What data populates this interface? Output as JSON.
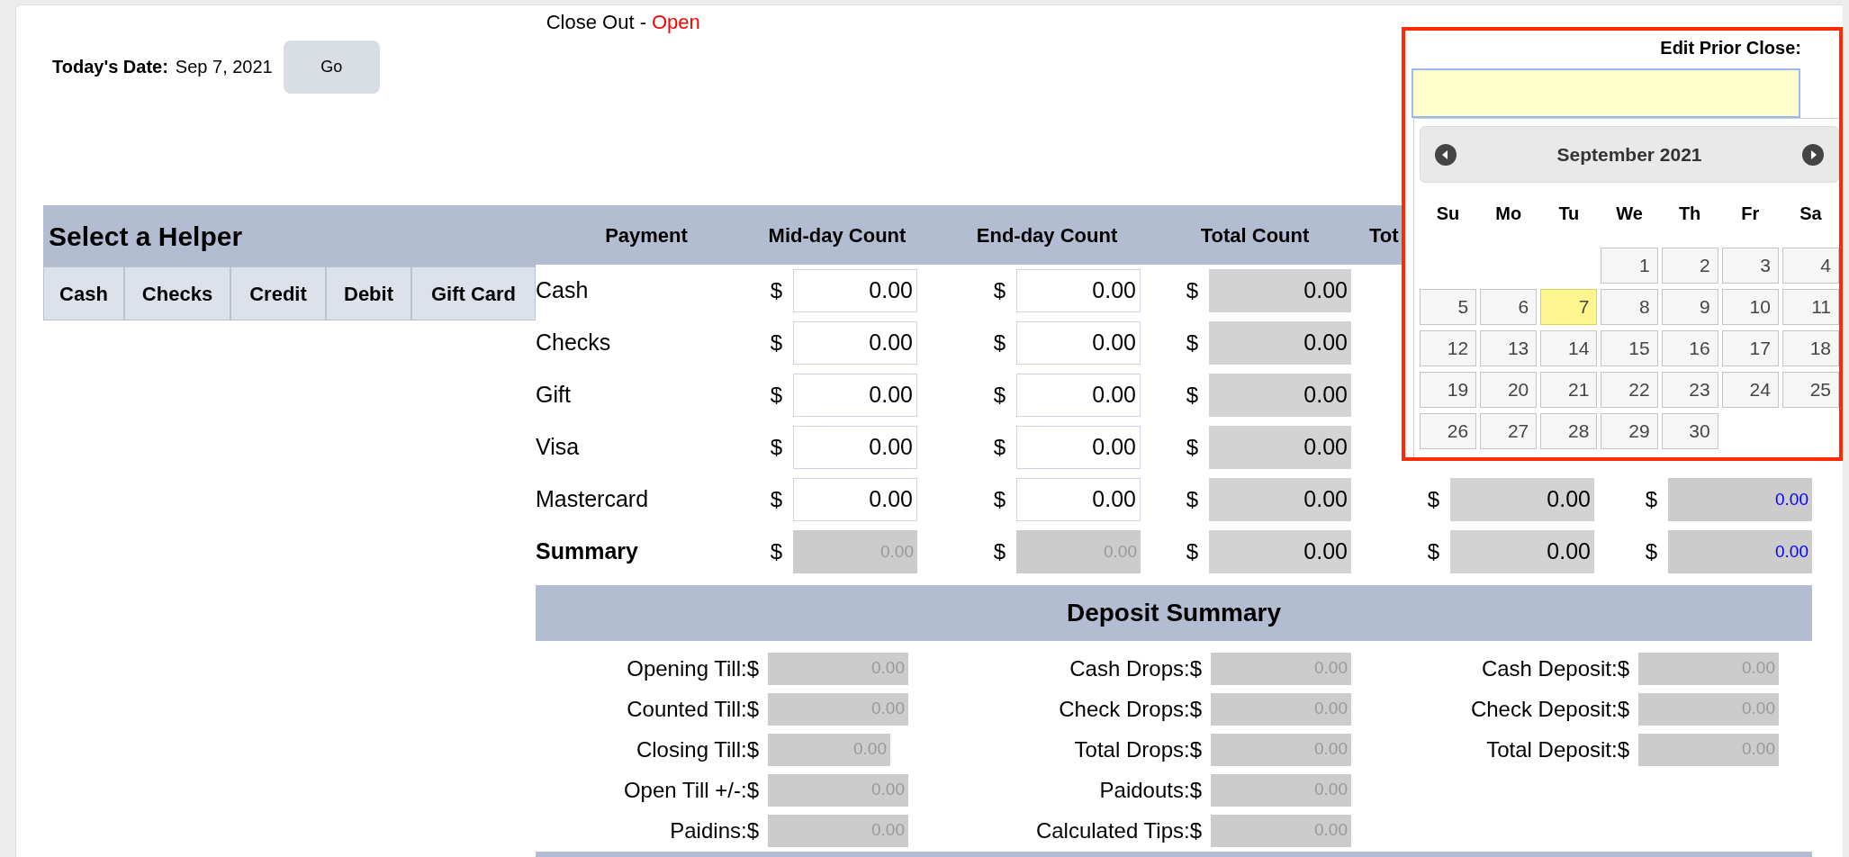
{
  "header": {
    "title": "Close Out -",
    "status": "Open",
    "date_label": "Today's Date:",
    "date": "Sep 7, 2021",
    "go_button": "Go"
  },
  "helper": {
    "title": "Select a Helper",
    "tabs": [
      "Cash",
      "Checks",
      "Credit",
      "Debit",
      "Gift Card"
    ]
  },
  "payments": {
    "columns": [
      "Payment",
      "Mid-day Count",
      "End-day Count",
      "Total Count",
      "Tot"
    ],
    "rows": [
      {
        "kind": "item",
        "cells": [
          {
            "kind": "label",
            "value": "Cash"
          },
          {
            "kind": "input",
            "currency": "$",
            "value": "0.00"
          },
          {
            "kind": "input",
            "currency": "$",
            "value": "0.00"
          },
          {
            "kind": "readonly",
            "currency": "$",
            "value": "0.00"
          }
        ]
      },
      {
        "kind": "item",
        "cells": [
          {
            "kind": "label",
            "value": "Checks"
          },
          {
            "kind": "input",
            "currency": "$",
            "value": "0.00"
          },
          {
            "kind": "input",
            "currency": "$",
            "value": "0.00"
          },
          {
            "kind": "readonly",
            "currency": "$",
            "value": "0.00"
          }
        ]
      },
      {
        "kind": "item",
        "cells": [
          {
            "kind": "label",
            "value": "Gift"
          },
          {
            "kind": "input",
            "currency": "$",
            "value": "0.00"
          },
          {
            "kind": "input",
            "currency": "$",
            "value": "0.00"
          },
          {
            "kind": "readonly",
            "currency": "$",
            "value": "0.00"
          }
        ]
      },
      {
        "kind": "item",
        "cells": [
          {
            "kind": "label",
            "value": "Visa"
          },
          {
            "kind": "input",
            "currency": "$",
            "value": "0.00"
          },
          {
            "kind": "input",
            "currency": "$",
            "value": "0.00"
          },
          {
            "kind": "readonly",
            "currency": "$",
            "value": "0.00"
          }
        ]
      },
      {
        "kind": "item",
        "cells": [
          {
            "kind": "label",
            "value": "Mastercard"
          },
          {
            "kind": "input",
            "currency": "$",
            "value": "0.00"
          },
          {
            "kind": "input",
            "currency": "$",
            "value": "0.00"
          },
          {
            "kind": "readonly",
            "currency": "$",
            "value": "0.00"
          },
          {
            "kind": "readonly",
            "currency": "$",
            "value": "0.00"
          },
          {
            "kind": "blue",
            "currency": "$",
            "value": "0.00"
          }
        ]
      },
      {
        "kind": "summary",
        "cells": [
          {
            "kind": "label",
            "value": "Summary"
          },
          {
            "kind": "muted",
            "currency": "$",
            "value": "0.00"
          },
          {
            "kind": "muted",
            "currency": "$",
            "value": "0.00"
          },
          {
            "kind": "readonly",
            "currency": "$",
            "value": "0.00"
          },
          {
            "kind": "readonly",
            "currency": "$",
            "value": "0.00"
          },
          {
            "kind": "blue",
            "currency": "$",
            "value": "0.00"
          }
        ]
      }
    ]
  },
  "deposit": {
    "title": "Deposit Summary",
    "columns": [
      [
        {
          "label": "Opening Till:$",
          "value": "0.00",
          "kind": "wide"
        },
        {
          "label": "Counted Till:$",
          "value": "0.00",
          "kind": "wide"
        },
        {
          "label": "Closing Till:$",
          "value": "0.00",
          "kind": "short"
        },
        {
          "label": "Open Till +/-:$",
          "value": "0.00",
          "kind": "wide"
        },
        {
          "label": "Paidins:$",
          "value": "0.00",
          "kind": "wide"
        }
      ],
      [
        {
          "label": "Cash Drops:$",
          "value": "0.00",
          "kind": "wide"
        },
        {
          "label": "Check Drops:$",
          "value": "0.00",
          "kind": "wide"
        },
        {
          "label": "Total Drops:$",
          "value": "0.00",
          "kind": "wide"
        },
        {
          "label": "Paidouts:$",
          "value": "0.00",
          "kind": "wide"
        },
        {
          "label": "Calculated Tips:$",
          "value": "0.00",
          "kind": "wide"
        }
      ],
      [
        {
          "label": "Cash Deposit:$",
          "value": "0.00",
          "kind": "wide"
        },
        {
          "label": "Check Deposit:$",
          "value": "0.00",
          "kind": "wide"
        },
        {
          "label": "Total Deposit:$",
          "value": "0.00",
          "kind": "wide"
        }
      ]
    ]
  },
  "prior_close": {
    "label": "Edit Prior Close:",
    "calendar": {
      "month": "September 2021",
      "weekdays": [
        "Su",
        "Mo",
        "Tu",
        "We",
        "Th",
        "Fr",
        "Sa"
      ],
      "weeks": [
        [
          {
            "kind": "blank"
          },
          {
            "kind": "blank"
          },
          {
            "kind": "blank"
          },
          {
            "kind": "day",
            "day": "1",
            "today": false
          },
          {
            "kind": "day",
            "day": "2",
            "today": false
          },
          {
            "kind": "day",
            "day": "3",
            "today": false
          },
          {
            "kind": "day",
            "day": "4",
            "today": false
          }
        ],
        [
          {
            "kind": "day",
            "day": "5",
            "today": false
          },
          {
            "kind": "day",
            "day": "6",
            "today": false
          },
          {
            "kind": "day",
            "day": "7",
            "today": true
          },
          {
            "kind": "day",
            "day": "8",
            "today": false
          },
          {
            "kind": "day",
            "day": "9",
            "today": false
          },
          {
            "kind": "day",
            "day": "10",
            "today": false
          },
          {
            "kind": "day",
            "day": "11",
            "today": false
          }
        ],
        [
          {
            "kind": "day",
            "day": "12",
            "today": false
          },
          {
            "kind": "day",
            "day": "13",
            "today": false
          },
          {
            "kind": "day",
            "day": "14",
            "today": false
          },
          {
            "kind": "day",
            "day": "15",
            "today": false
          },
          {
            "kind": "day",
            "day": "16",
            "today": false
          },
          {
            "kind": "day",
            "day": "17",
            "today": false
          },
          {
            "kind": "day",
            "day": "18",
            "today": false
          }
        ],
        [
          {
            "kind": "day",
            "day": "19",
            "today": false
          },
          {
            "kind": "day",
            "day": "20",
            "today": false
          },
          {
            "kind": "day",
            "day": "21",
            "today": false
          },
          {
            "kind": "day",
            "day": "22",
            "today": false
          },
          {
            "kind": "day",
            "day": "23",
            "today": false
          },
          {
            "kind": "day",
            "day": "24",
            "today": false
          },
          {
            "kind": "day",
            "day": "25",
            "today": false
          }
        ],
        [
          {
            "kind": "day",
            "day": "26",
            "today": false
          },
          {
            "kind": "day",
            "day": "27",
            "today": false
          },
          {
            "kind": "day",
            "day": "28",
            "today": false
          },
          {
            "kind": "day",
            "day": "29",
            "today": false
          },
          {
            "kind": "day",
            "day": "30",
            "today": false
          },
          {
            "kind": "blank"
          },
          {
            "kind": "blank"
          }
        ]
      ]
    }
  }
}
